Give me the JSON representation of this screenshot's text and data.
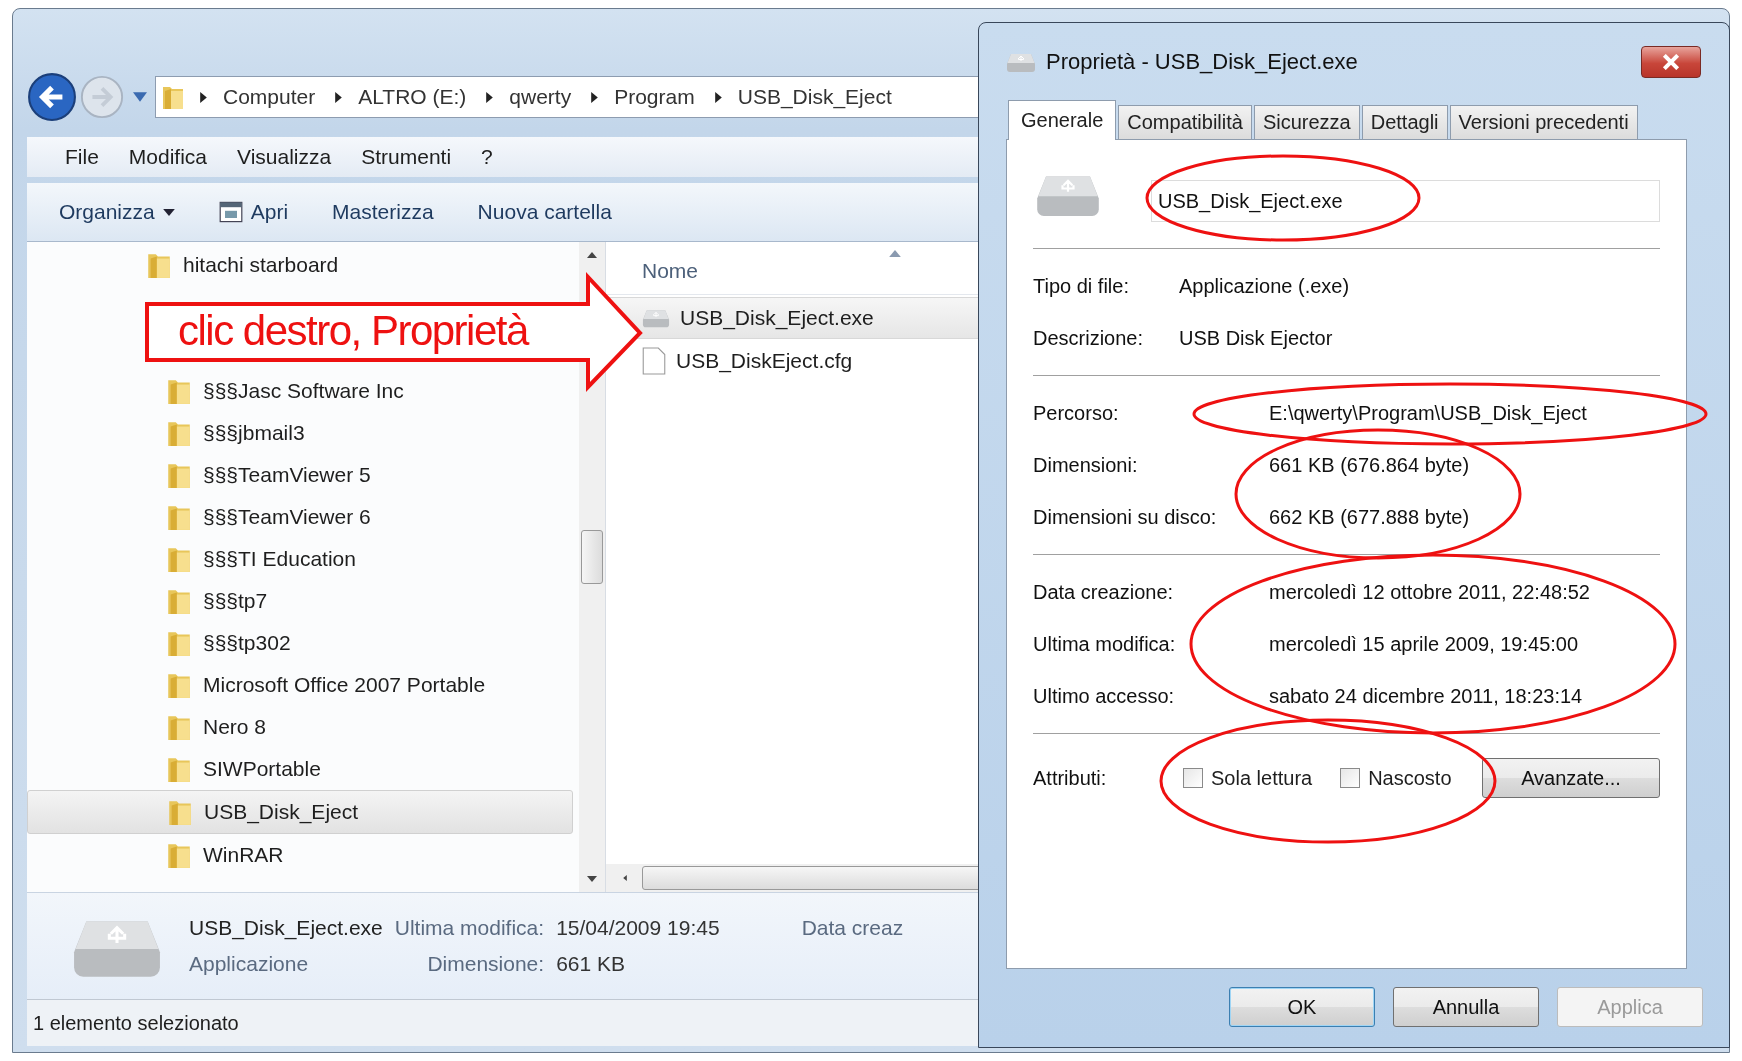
{
  "explorer": {
    "breadcrumb": [
      "Computer",
      "ALTRO (E:)",
      "qwerty",
      "Program",
      "USB_Disk_Eject"
    ],
    "menu": [
      "File",
      "Modifica",
      "Visualizza",
      "Strumenti",
      "?"
    ],
    "toolbar": [
      {
        "label": "Organizza",
        "kind": "dropdown"
      },
      {
        "label": "Apri",
        "kind": "icon"
      },
      {
        "label": "Masterizza",
        "kind": "plain"
      },
      {
        "label": "Nuova cartella",
        "kind": "plain"
      }
    ],
    "tree": {
      "items": [
        {
          "label": "hitachi starboard",
          "selected": false
        }
      ],
      "nested_items": [
        {
          "label": "§§§Jasc Software Inc",
          "selected": false
        },
        {
          "label": "§§§jbmail3",
          "selected": false
        },
        {
          "label": "§§§TeamViewer 5",
          "selected": false
        },
        {
          "label": "§§§TeamViewer 6",
          "selected": false
        },
        {
          "label": "§§§TI Education",
          "selected": false
        },
        {
          "label": "§§§tp7",
          "selected": false
        },
        {
          "label": "§§§tp302",
          "selected": false
        },
        {
          "label": "Microsoft Office 2007 Portable",
          "selected": false
        },
        {
          "label": "Nero 8",
          "selected": false
        },
        {
          "label": "SIWPortable",
          "selected": false
        },
        {
          "label": "USB_Disk_Eject",
          "selected": true
        },
        {
          "label": "WinRAR",
          "selected": false
        }
      ]
    },
    "files": {
      "column": "Nome",
      "rows": [
        {
          "name": "USB_Disk_Eject.exe",
          "kind": "app",
          "selected": true
        },
        {
          "name": "USB_DiskEject.cfg",
          "kind": "doc",
          "selected": false
        }
      ]
    },
    "details": {
      "name": "USB_Disk_Eject.exe",
      "type": "Applicazione",
      "fields": [
        {
          "label": "Ultima modifica:",
          "value": "15/04/2009 19:45"
        },
        {
          "label": "Dimensione:",
          "value": "661 KB"
        }
      ],
      "cut_label": "Data creaz"
    },
    "status_bar": "1 elemento selezionato"
  },
  "dialog": {
    "title": "Proprietà - USB_Disk_Eject.exe",
    "tabs": [
      {
        "label": "Generale",
        "selected": true
      },
      {
        "label": "Compatibilità",
        "selected": false
      },
      {
        "label": "Sicurezza",
        "selected": false
      },
      {
        "label": "Dettagli",
        "selected": false
      },
      {
        "label": "Versioni precedenti",
        "selected": false
      }
    ],
    "file_name": "USB_Disk_Eject.exe",
    "groups": [
      [
        {
          "label": "Tipo di file:",
          "value": "Applicazione (.exe)"
        },
        {
          "label": "Descrizione:",
          "value": "USB Disk Ejector"
        }
      ],
      [
        {
          "label": "Percorso:",
          "value": "E:\\qwerty\\Program\\USB_Disk_Eject"
        },
        {
          "label": "Dimensioni:",
          "value": "661 KB (676.864 byte)"
        },
        {
          "label": "Dimensioni su disco:",
          "value": "662 KB (677.888 byte)"
        }
      ],
      [
        {
          "label": "Data creazione:",
          "value": "mercoledì 12 ottobre 2011, 22:48:52"
        },
        {
          "label": "Ultima modifica:",
          "value": "mercoledì 15 aprile 2009, 19:45:00"
        },
        {
          "label": "Ultimo accesso:",
          "value": "sabato 24 dicembre 2011, 18:23:14"
        }
      ]
    ],
    "attributes": {
      "label": "Attributi:",
      "checkboxes": [
        {
          "label": "Sola lettura",
          "checked": false
        },
        {
          "label": "Nascosto",
          "checked": false
        }
      ],
      "advanced": "Avanzate..."
    },
    "buttons": [
      {
        "label": "OK",
        "disabled": false,
        "default": true
      },
      {
        "label": "Annulla",
        "disabled": false,
        "default": false
      },
      {
        "label": "Applica",
        "disabled": true,
        "default": false
      }
    ]
  },
  "annotation": {
    "callout": "clic destro, Proprietà"
  }
}
